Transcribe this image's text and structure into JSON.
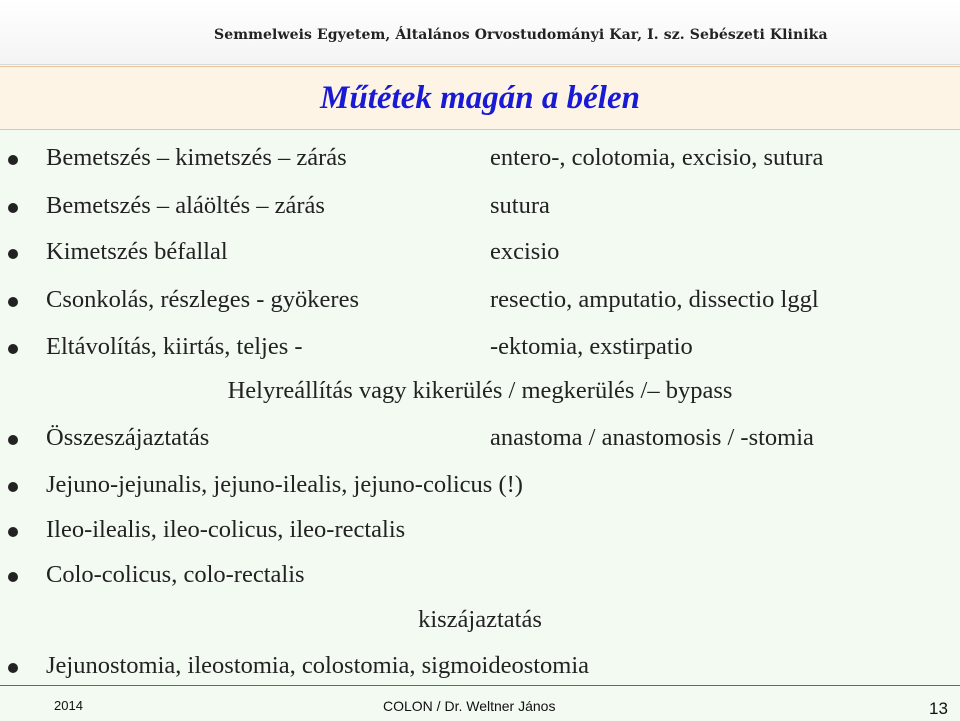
{
  "header": {
    "institution": "Semmelweis Egyetem, Általános Orvostudományi Kar, I. sz. Sebészeti Klinika",
    "title": "Műtétek magán a bélen"
  },
  "rows": [
    {
      "left": "Bemetszés – kimetszés – zárás",
      "right": "entero-, colotomia, excisio, sutura"
    },
    {
      "left": "Bemetszés – aláöltés – zárás",
      "right": "sutura"
    },
    {
      "left": "Kimetszés béfallal",
      "right": "excisio"
    },
    {
      "left": "Csonkolás, részleges - gyökeres",
      "right": "resectio, amputatio, dissectio lggl"
    },
    {
      "left": "Eltávolítás, kiirtás, teljes -",
      "right": "-ektomia, exstirpatio"
    },
    {
      "center": "Helyreállítás vagy kikerülés / megkerülés /– bypass"
    },
    {
      "left": "Összeszájaztatás",
      "right": "anastoma / anastomosis / -stomia"
    },
    {
      "left": "Jejuno-jejunalis, jejuno-ilealis, jejuno-colicus (!)"
    },
    {
      "left": "Ileo-ilealis, ileo-colicus, ileo-rectalis"
    },
    {
      "left": "Colo-colicus, colo-rectalis"
    },
    {
      "center": "kiszájaztatás"
    },
    {
      "left": "Jejunostomia, ileostomia, colostomia, sigmoideostomia"
    }
  ],
  "footer": {
    "year": "2014",
    "center": "COLON / Dr. Weltner János",
    "page": "13"
  }
}
